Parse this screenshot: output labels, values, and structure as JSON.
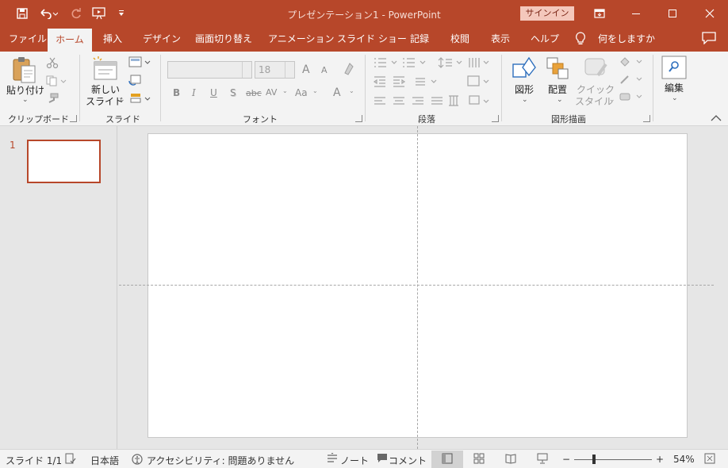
{
  "titlebar": {
    "title": "プレゼンテーション1  -  PowerPoint",
    "signin_label": "サインイン",
    "icons": [
      "save-icon",
      "undo-icon",
      "redo-icon",
      "start-presentation-icon",
      "customize-toolbar-icon",
      "ribbon-display-options-icon",
      "minimize-icon",
      "maximize-icon",
      "close-icon"
    ]
  },
  "tabs": [
    "ファイル",
    "ホーム",
    "挿入",
    "デザイン",
    "画面切り替え",
    "アニメーション",
    "スライド ショー",
    "記録",
    "校閲",
    "表示",
    "ヘルプ"
  ],
  "active_tab": "ホーム",
  "tell_me": "何をしますか",
  "ribbon": {
    "clipboard": {
      "label": "クリップボード",
      "paste": "貼り付け"
    },
    "slides": {
      "label": "スライド",
      "new_slide_line1": "新しい",
      "new_slide_line2": "スライド"
    },
    "font": {
      "label": "フォント",
      "font_size": "18",
      "grow": "A",
      "shrink": "A",
      "bold": "B",
      "italic": "I",
      "underline": "U",
      "shadow": "S",
      "strike": "abc",
      "spacing": "AV",
      "case": "Aa",
      "color": "A"
    },
    "paragraph": {
      "label": "段落"
    },
    "drawing": {
      "label": "図形描画",
      "shapes": "図形",
      "arrange": "配置",
      "quick_style_line1": "クイック",
      "quick_style_line2": "スタイル"
    },
    "editing": {
      "label": "編集"
    }
  },
  "slides_panel": {
    "slide_number": "1"
  },
  "statusbar": {
    "slide_info": "スライド 1/1",
    "language": "日本語",
    "accessibility": "アクセシビリティ: 問題ありません",
    "notes": "ノート",
    "comments": "コメント",
    "zoom_minus": "−",
    "zoom_plus": "+",
    "zoom": "54%",
    "zoom_level": 54
  },
  "colors": {
    "accent": "#b7472a",
    "ribbon_bg": "#f3f3f3",
    "workspace_bg": "#e6e6e6"
  }
}
